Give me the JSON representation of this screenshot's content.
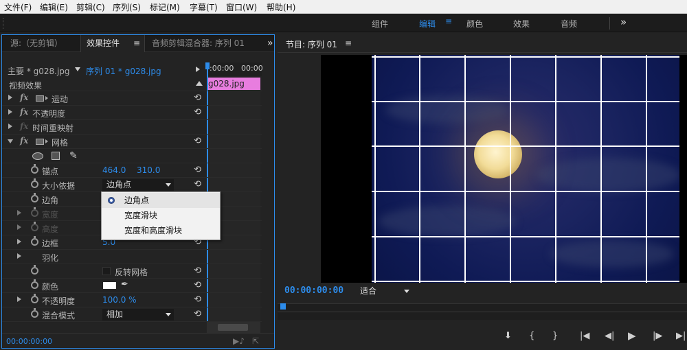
{
  "menu": [
    "文件(F)",
    "编辑(E)",
    "剪辑(C)",
    "序列(S)",
    "标记(M)",
    "字幕(T)",
    "窗口(W)",
    "帮助(H)"
  ],
  "workspaces": {
    "items": [
      "组件",
      "编辑",
      "颜色",
      "效果",
      "音频"
    ],
    "active": "编辑",
    "menu_icon": "≡",
    "more": "»"
  },
  "left_tabs": [
    "源:（无剪辑）",
    "效果控件",
    "音频剪辑混合器: 序列 01"
  ],
  "left_tabs_menu": "≡",
  "left_more": "»",
  "clip_bar": {
    "master": "主要 * g028.jpg",
    "sequence": "序列 01 * g028.jpg",
    "time_start": ":00:00",
    "time_end": "00:00",
    "clip_name": "g028.jpg"
  },
  "effects": {
    "section": "视频效果",
    "motion": "运动",
    "opacity": "不透明度",
    "time_remap": "时间重映射",
    "grid": "网格",
    "anchor_label": "锚点",
    "anchor_x": "464.0",
    "anchor_y": "310.0",
    "size_from_label": "大小依据",
    "size_from_value": "边角点",
    "corner_label": "边角",
    "width_label": "宽度",
    "height_label": "高度",
    "border_label": "边框",
    "border_value": "5.0",
    "feather_label": "羽化",
    "invert_label": "反转网格",
    "color_label": "颜色",
    "opacity2_label": "不透明度",
    "opacity2_value": "100.0 %",
    "blend_label": "混合模式",
    "blend_value": "相加"
  },
  "popup": {
    "options": [
      "边角点",
      "宽度滑块",
      "宽度和高度滑块"
    ],
    "selected": "边角点"
  },
  "left_footer_time": "00:00:00:00",
  "program": {
    "title": "节目: 序列 01",
    "menu_icon": "≡",
    "timecode": "00:00:00:00",
    "fit": "适合"
  },
  "colors": {
    "accent": "#2d8ceb",
    "clip": "#e87ddf",
    "grid_line": "#ffffff",
    "moon": "#f2dc98"
  }
}
